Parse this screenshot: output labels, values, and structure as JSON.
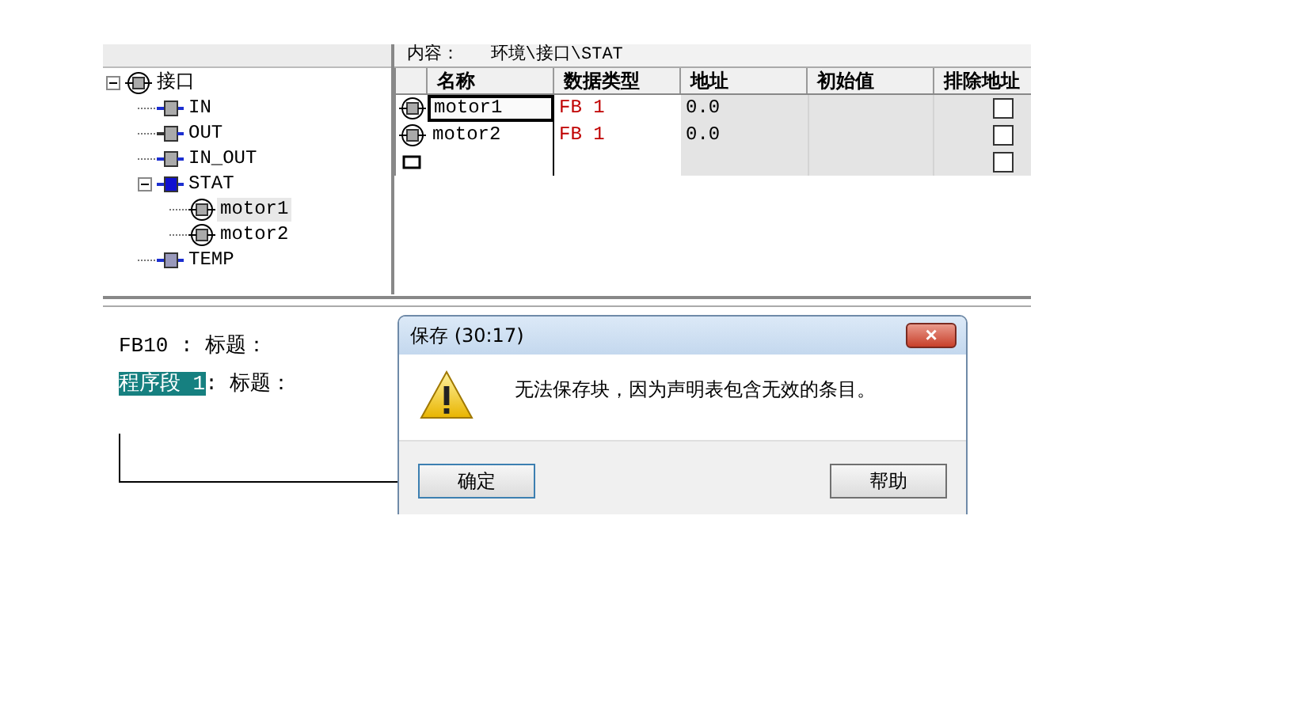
{
  "breadcrumb": "内容：   环境\\接口\\STAT",
  "tree": [
    {
      "label": "接口",
      "kind": "struct",
      "expanded": true,
      "selected": false,
      "children": [
        {
          "label": "IN",
          "kind": "in",
          "selected": false
        },
        {
          "label": "OUT",
          "kind": "out",
          "selected": false
        },
        {
          "label": "IN_OUT",
          "kind": "inout",
          "selected": false
        },
        {
          "label": "STAT",
          "kind": "stat",
          "expanded": true,
          "selected": false,
          "children": [
            {
              "label": "motor1",
              "kind": "struct",
              "selected": true
            },
            {
              "label": "motor2",
              "kind": "struct",
              "selected": false
            }
          ]
        },
        {
          "label": "TEMP",
          "kind": "temp",
          "selected": false
        }
      ]
    }
  ],
  "table": {
    "columns": [
      "名称",
      "数据类型",
      "地址",
      "初始值",
      "排除地址"
    ],
    "rows": [
      {
        "kind": "entry",
        "name": "motor1",
        "type": "FB 1",
        "address": "0.0",
        "selected": true,
        "checked": false
      },
      {
        "kind": "entry",
        "name": "motor2",
        "type": "FB 1",
        "address": "0.0",
        "selected": false,
        "checked": false
      },
      {
        "kind": "new",
        "selected": false,
        "checked": false
      }
    ]
  },
  "editor": {
    "block_title": "FB10 : 标题：",
    "network_label": "程序段 1",
    "network_title": ": 标题："
  },
  "dialog": {
    "title": "保存 (30:17)",
    "close": "×",
    "message": "无法保存块，因为声明表包含无效的条目。",
    "buttons": [
      "确定",
      "帮助"
    ]
  }
}
